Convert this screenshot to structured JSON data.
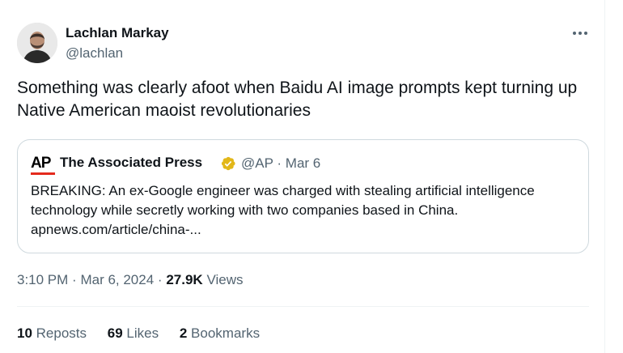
{
  "author": {
    "name": "Lachlan Markay",
    "handle": "@lachlan"
  },
  "tweet": {
    "text": "Something was clearly afoot when Baidu AI image prompts kept turning up Native American maoist revolutionaries"
  },
  "quoted": {
    "logo_text": "AP",
    "name": "The Associated Press",
    "handle": "@AP",
    "separator": "·",
    "date": "Mar 6",
    "text": "BREAKING: An ex-Google engineer was charged with stealing artificial intelligence technology while secretly working with two companies based in China. apnews.com/article/china-..."
  },
  "meta": {
    "time": "3:10 PM",
    "sep1": "·",
    "date": "Mar 6, 2024",
    "sep2": "·",
    "views_count": "27.9K",
    "views_label": "Views"
  },
  "stats": {
    "reposts_count": "10",
    "reposts_label": "Reposts",
    "likes_count": "69",
    "likes_label": "Likes",
    "bookmarks_count": "2",
    "bookmarks_label": "Bookmarks"
  },
  "icons": {
    "more": "more-horizontal-icon",
    "verified": "verified-gold-badge-icon"
  },
  "colors": {
    "text_primary": "#0f1419",
    "text_secondary": "#536471",
    "border": "#cfd9de",
    "ap_red": "#e42a1d",
    "verified_gold": "#e2b719"
  }
}
